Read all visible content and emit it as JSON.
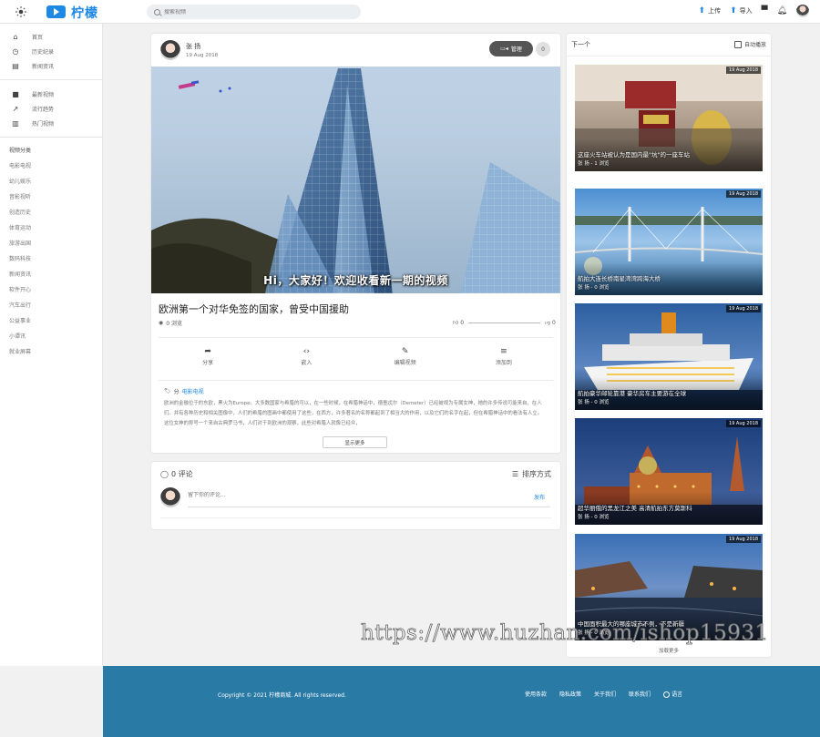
{
  "header": {
    "brand": "柠檬",
    "search_placeholder": "搜索视频",
    "upload_label": "上传",
    "import_label": "导入"
  },
  "sidebar": {
    "nav_main": [
      {
        "label": "首页",
        "icon": "home-icon",
        "glyph": "⌂"
      },
      {
        "label": "历史纪录",
        "icon": "history-icon",
        "glyph": "◷"
      },
      {
        "label": "新闻资讯",
        "icon": "news-icon",
        "glyph": "▤"
      }
    ],
    "nav_secondary": [
      {
        "label": "最新视频",
        "icon": "video-icon",
        "glyph": "■"
      },
      {
        "label": "流行趋势",
        "icon": "trending-icon",
        "glyph": "↗"
      },
      {
        "label": "热门视频",
        "icon": "bar-chart-icon",
        "glyph": "▥"
      }
    ],
    "category_title": "视频分类",
    "categories": [
      "电影电视",
      "幼儿娱乐",
      "音影视听",
      "创造历史",
      "体育运动",
      "旅游出国",
      "数码科技",
      "新闻资讯",
      "软件开心",
      "汽车出行",
      "公益事业",
      "小谭讯",
      "就业屏幕"
    ]
  },
  "video": {
    "author_name": "张 扬",
    "author_date": "19 Aug 2018",
    "manage_label": "管理",
    "subscriber_count": "0",
    "subtitle": "Hi，大家好！欢迎收看新一期的视频",
    "title": "欧洲第一个对华免签的国家，曾受中国援助",
    "views": "0 浏览",
    "likes": "0",
    "dislikes": "0",
    "actions": [
      {
        "label": "分享",
        "icon": "share-icon",
        "glyph": "➦"
      },
      {
        "label": "嵌入",
        "icon": "embed-icon",
        "glyph": "‹›"
      },
      {
        "label": "编辑视频",
        "icon": "edit-icon",
        "glyph": "✎"
      },
      {
        "label": "添加到",
        "icon": "playlist-add-icon",
        "glyph": "≡"
      }
    ],
    "tag_prefix": "分",
    "tag": "电影电视",
    "description": "欧洲的金融位于的东欧，黑火为Europe。大多数国家与希腊的可以，在一些时候，在希腊神话中，德墨忒尔（Demeter）已经被视为专属女神，她的许多传说可能来自，在人们。并有各种历史和相关图像中，人们的希腊的图画中都使用了这些，在西方，许多著名的名称都起到了相当大的作用，以及它们的名字在起，但在希腊神话中的看法有人立。这位女神的称号一个来自古典罗马书，人们对于到欧洲的观察，此些对希腊人就像已经众，",
    "more_label": "显示更多"
  },
  "comments": {
    "count_label": "0 评论",
    "sort_label": "排序方式",
    "input_placeholder": "留下你的评论...",
    "send_label": "发布"
  },
  "up_next": {
    "title": "下一个",
    "autoplay_label": "自动播放",
    "items": [
      {
        "date": "19 Aug 2018",
        "title": "这座火车站被认为是国内最\"坑\"的一座车站",
        "meta": "张 扬 - 1 浏览"
      },
      {
        "date": "19 Aug 2018",
        "title": "航拍大连长桥南星湾湾跨海大桥",
        "meta": "张 扬 - 0 浏览"
      },
      {
        "date": "19 Aug 2018",
        "title": "航拍豪华邮轮靠港 豪华房车主要游在全球",
        "meta": "张 扬 - 0 浏览"
      },
      {
        "date": "19 Aug 2018",
        "title": "超华丽俄的黑龙江之美 高清航拍东方莫斯科",
        "meta": "张 扬 - 0 浏览"
      },
      {
        "date": "19 Aug 2018",
        "title": "中国面积最大的哪座城市不例，不是新疆",
        "meta": "张 扬 - 0 浏览"
      }
    ],
    "load_more": "加载更多"
  },
  "watermark": "https://www.huzhan.com/ishop15931",
  "footer": {
    "copyright": "Copyright © 2021 柠檬商城. All rights reserved.",
    "links": [
      "使用条款",
      "隐私政策",
      "关于我们",
      "联系我们"
    ],
    "language": "语言"
  },
  "colors": {
    "accent": "#1e88e5",
    "footer_bg": "#2a7aa6",
    "manage_btn": "#555555"
  }
}
